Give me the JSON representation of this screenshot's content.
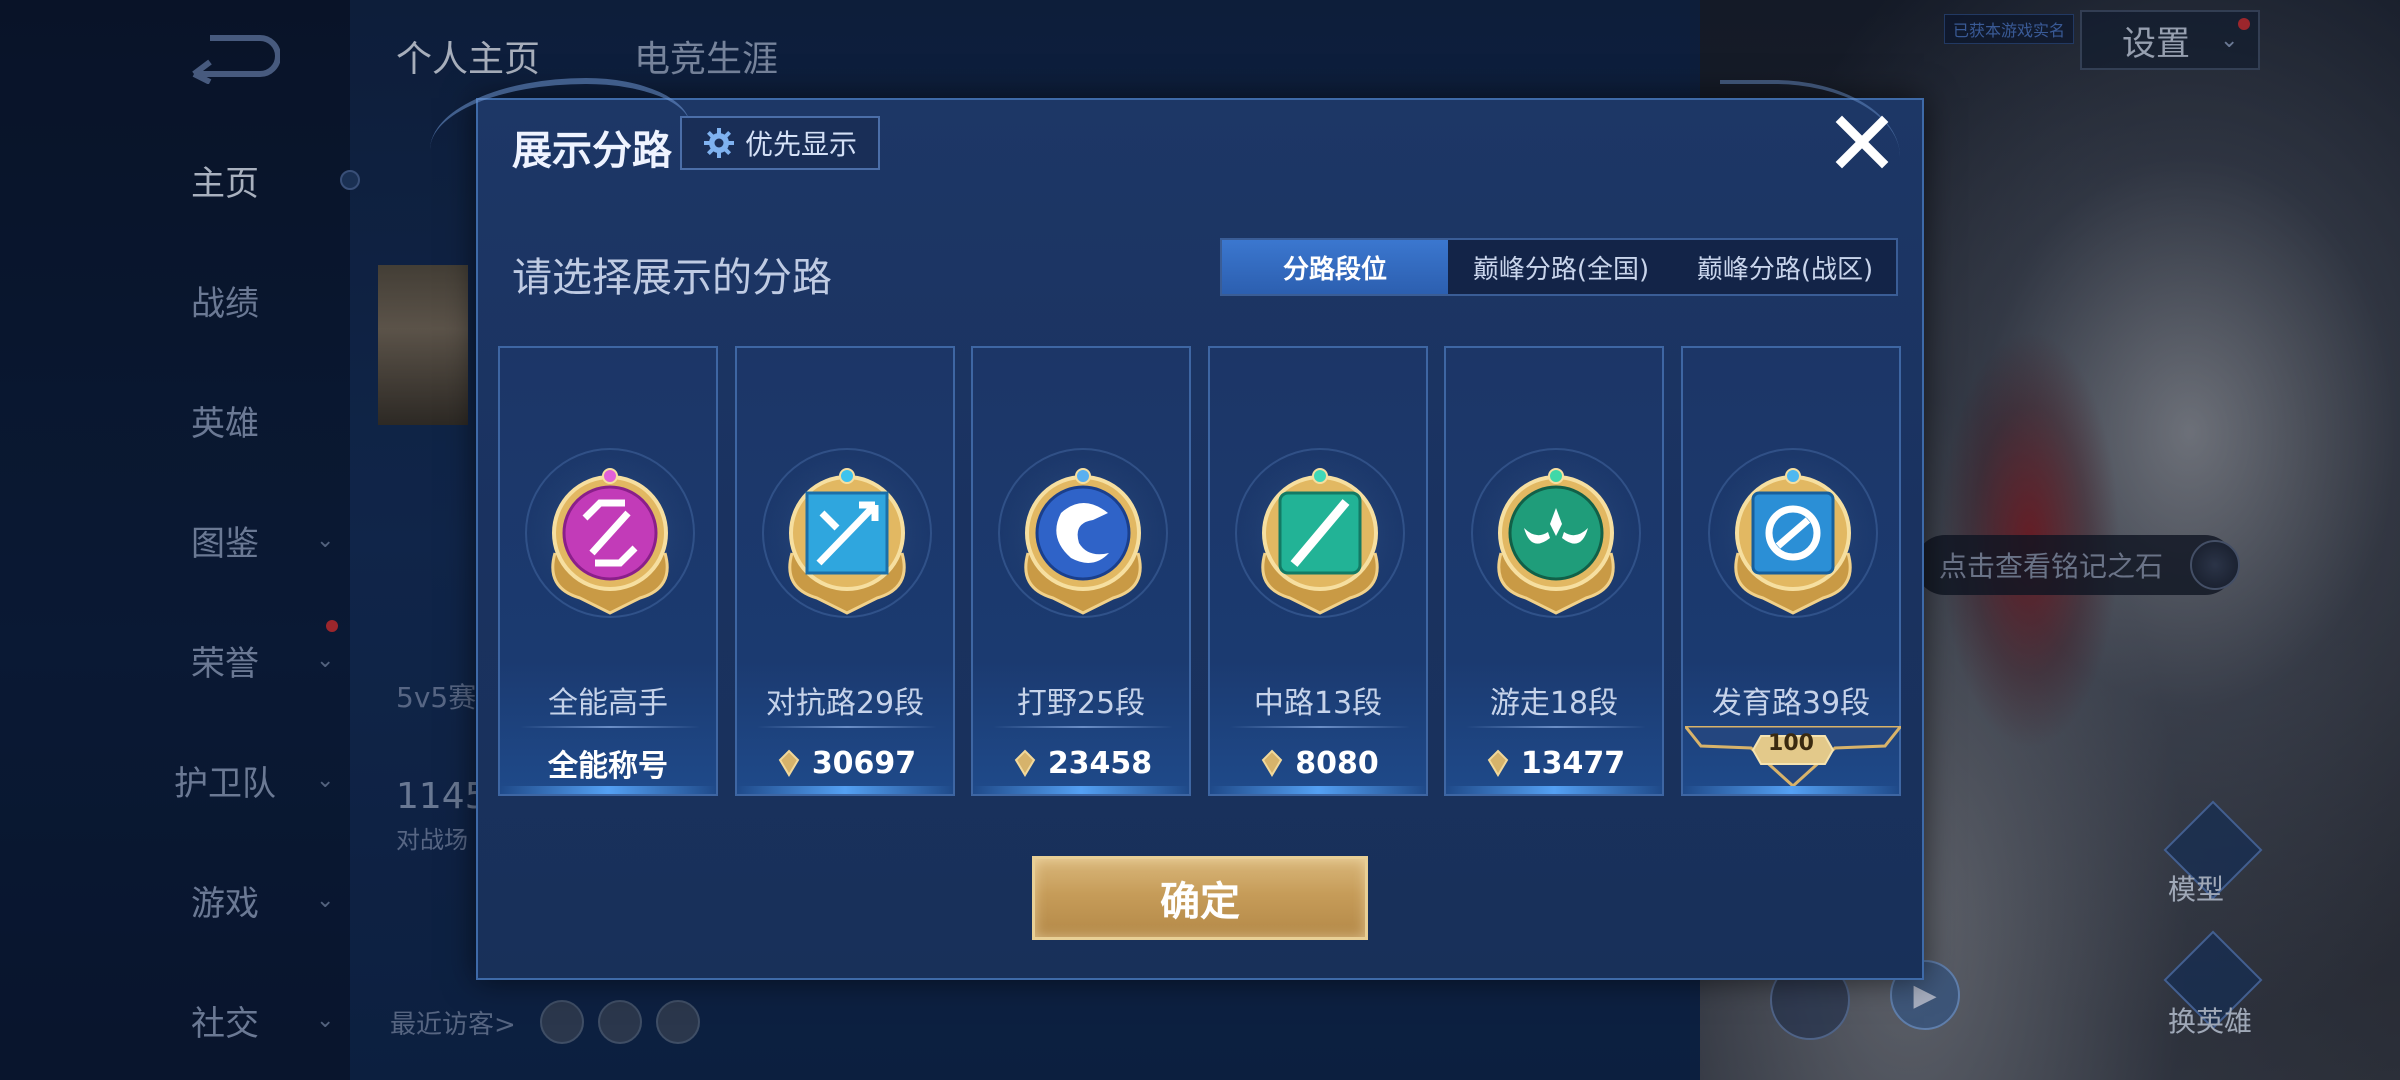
{
  "background": {
    "top_tabs": [
      "个人主页",
      "电竞生涯"
    ],
    "settings_label": "设置",
    "top_small_tag": "已获本游戏实名",
    "nav": [
      {
        "label": "主页",
        "active": true,
        "chevron": false
      },
      {
        "label": "战绩",
        "active": false,
        "chevron": false
      },
      {
        "label": "英雄",
        "active": false,
        "chevron": false
      },
      {
        "label": "图鉴",
        "active": false,
        "chevron": true
      },
      {
        "label": "荣誉",
        "active": false,
        "chevron": true
      },
      {
        "label": "护卫队",
        "active": false,
        "chevron": true
      },
      {
        "label": "游戏",
        "active": false,
        "chevron": true
      },
      {
        "label": "社交",
        "active": false,
        "chevron": true
      }
    ],
    "chevron_glyph": "⌄",
    "mode_text": "5v5赛",
    "number_text": "1145",
    "battle_text": "对战场",
    "recent_visitors_label": "最近访客>",
    "inscription_hint": "点击查看铭记之石",
    "right_buttons": [
      "模型",
      "换英雄"
    ]
  },
  "modal": {
    "title": "展示分路",
    "priority_button": "优先显示",
    "subtitle": "请选择展示的分路",
    "tabs": [
      {
        "label": "分路段位",
        "active": true
      },
      {
        "label": "巅峰分路(全国)",
        "active": false
      },
      {
        "label": "巅峰分路(战区)",
        "active": false
      }
    ],
    "cards": [
      {
        "name": "全能高手",
        "value": "全能称号",
        "kind": "title",
        "badge_color": "#c23bb8",
        "badge_symbol": "allround-icon"
      },
      {
        "name": "对抗路29段",
        "value": "30697",
        "kind": "score",
        "badge_color": "#2fa6de",
        "badge_symbol": "sword-icon"
      },
      {
        "name": "打野25段",
        "value": "23458",
        "kind": "score",
        "badge_color": "#2f63c8",
        "badge_symbol": "dragon-icon"
      },
      {
        "name": "中路13段",
        "value": "8080",
        "kind": "score",
        "badge_color": "#22b396",
        "badge_symbol": "wand-icon"
      },
      {
        "name": "游走18段",
        "value": "13477",
        "kind": "score",
        "badge_color": "#1f9d7a",
        "badge_symbol": "wings-icon"
      },
      {
        "name": "发育路39段",
        "value": "100",
        "kind": "rank-banner",
        "badge_color": "#2b8fd6",
        "badge_symbol": "target-icon"
      }
    ],
    "confirm_label": "确定"
  },
  "colors": {
    "gold": "#c9a35f",
    "accent_blue": "#3b77cf",
    "modal_bg": "#1d3766"
  }
}
